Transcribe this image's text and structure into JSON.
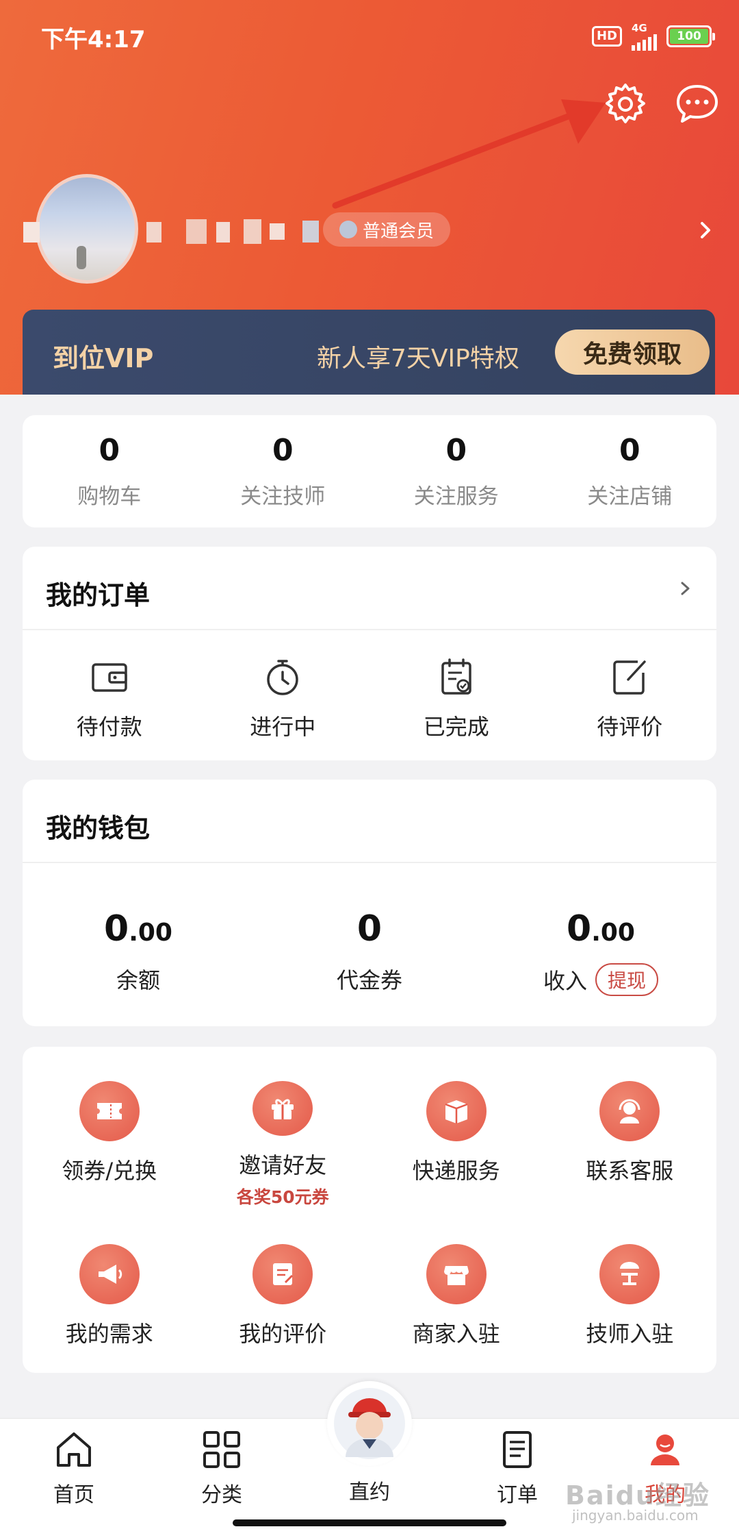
{
  "status_bar": {
    "time": "下午4:17",
    "hd": "HD",
    "network": "4G",
    "battery": "100"
  },
  "profile": {
    "member_level": "普通会员"
  },
  "vip": {
    "title": "到位VIP",
    "promo": "新人享7天VIP特权",
    "button": "免费领取"
  },
  "stats": [
    {
      "value": "0",
      "label": "购物车"
    },
    {
      "value": "0",
      "label": "关注技师"
    },
    {
      "value": "0",
      "label": "关注服务"
    },
    {
      "value": "0",
      "label": "关注店铺"
    }
  ],
  "orders": {
    "title": "我的订单",
    "items": [
      {
        "label": "待付款",
        "icon": "wallet-icon"
      },
      {
        "label": "进行中",
        "icon": "timer-icon"
      },
      {
        "label": "已完成",
        "icon": "clipboard-check-icon"
      },
      {
        "label": "待评价",
        "icon": "edit-icon"
      }
    ]
  },
  "wallet": {
    "title": "我的钱包",
    "items": [
      {
        "int": "0",
        "dec": ".00",
        "label": "余额"
      },
      {
        "int": "0",
        "dec": "",
        "label": "代金券"
      },
      {
        "int": "0",
        "dec": ".00",
        "label": "收入"
      }
    ],
    "withdraw": "提现"
  },
  "services": [
    {
      "label": "领券/兑换",
      "icon": "ticket-icon"
    },
    {
      "label": "邀请好友",
      "sub": "各奖50元券",
      "icon": "gift-icon"
    },
    {
      "label": "快递服务",
      "icon": "package-icon"
    },
    {
      "label": "联系客服",
      "icon": "headset-icon"
    },
    {
      "label": "我的需求",
      "icon": "megaphone-icon"
    },
    {
      "label": "我的评价",
      "icon": "review-icon"
    },
    {
      "label": "商家入驻",
      "icon": "store-icon"
    },
    {
      "label": "技师入驻",
      "icon": "worker-icon"
    }
  ],
  "tabs": [
    {
      "label": "首页",
      "icon": "home-icon"
    },
    {
      "label": "分类",
      "icon": "grid-icon"
    },
    {
      "label": "直约",
      "icon": "avatar-icon"
    },
    {
      "label": "订单",
      "icon": "orders-icon"
    },
    {
      "label": "我的",
      "icon": "profile-icon"
    }
  ],
  "colors": {
    "header": "#ec5a35",
    "accent": "#d94337",
    "vip_bg": "#3b4a6c",
    "vip_gold": "#f4d2a6"
  },
  "watermark": {
    "main": "Baidu经验",
    "sub": "jingyan.baidu.com"
  }
}
